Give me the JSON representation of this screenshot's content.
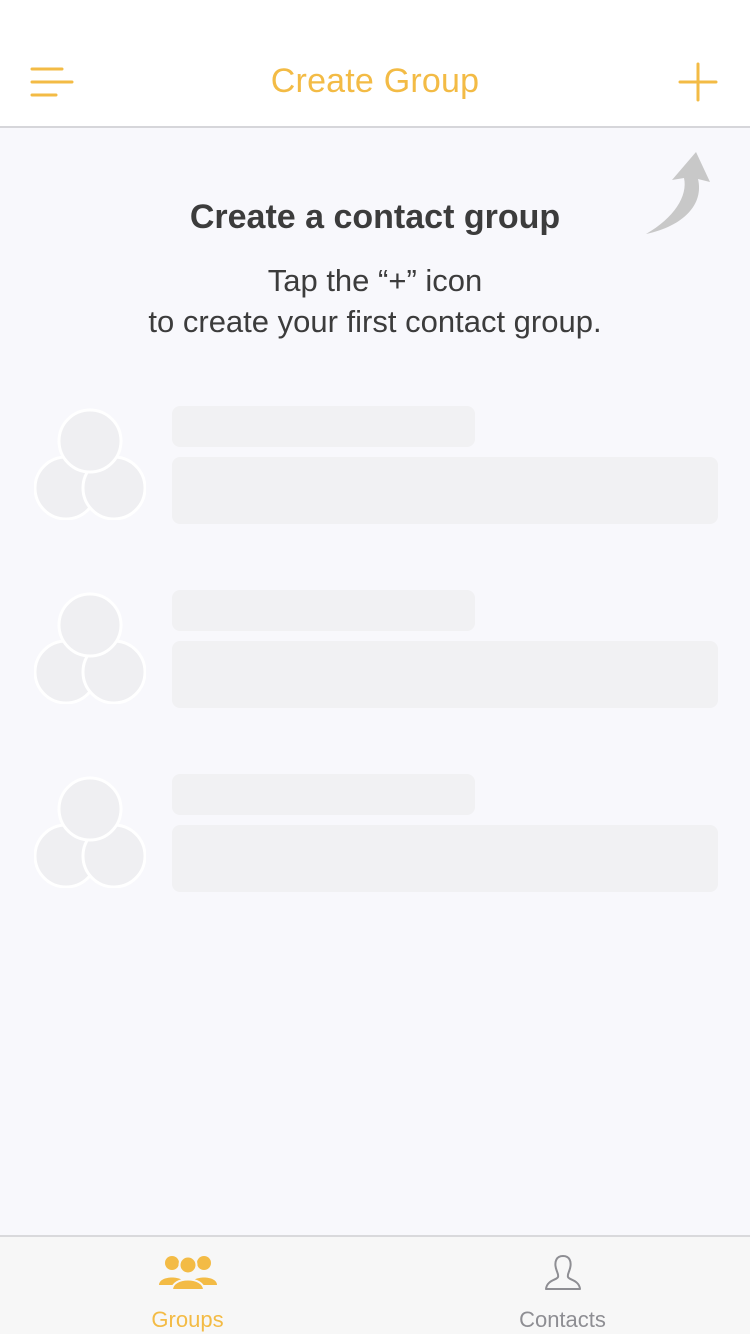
{
  "colors": {
    "accent": "#f3bb45",
    "placeholder": "#f1f1f3",
    "text_dark": "#3c3c3c",
    "tab_inactive": "#8e8e93",
    "arrow": "#c8c8c8"
  },
  "navbar": {
    "title": "Create Group",
    "left_icon": "menu-icon",
    "right_icon": "plus-icon"
  },
  "empty_state": {
    "title": "Create a contact group",
    "line1": "Tap the “+” icon",
    "line2": "to create your first contact group.",
    "arrow_icon": "curved-arrow-up-icon"
  },
  "placeholder_rows": [
    {
      "avatar_icon": "group-placeholder-icon"
    },
    {
      "avatar_icon": "group-placeholder-icon"
    },
    {
      "avatar_icon": "group-placeholder-icon"
    }
  ],
  "tabbar": {
    "tabs": [
      {
        "label": "Groups",
        "icon": "groups-icon",
        "active": true
      },
      {
        "label": "Contacts",
        "icon": "contact-icon",
        "active": false
      }
    ]
  }
}
